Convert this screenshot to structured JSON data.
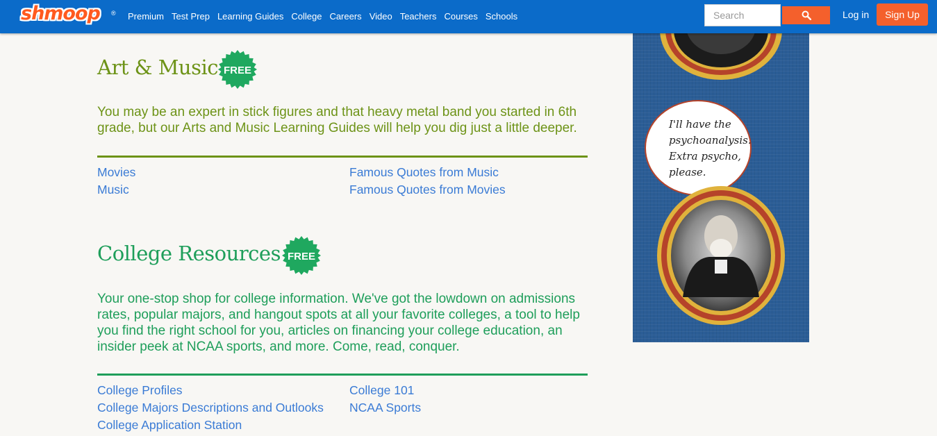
{
  "nav": {
    "logo": "shmoop",
    "registered": "®",
    "links": [
      "Premium",
      "Test Prep",
      "Learning Guides",
      "College",
      "Careers",
      "Video",
      "Teachers",
      "Courses",
      "Schools"
    ],
    "search_placeholder": "Search",
    "search_icon": "magnifier-icon",
    "login": "Log in",
    "signup": "Sign Up"
  },
  "sections": {
    "art": {
      "title": "Art & Music",
      "badge": "FREE",
      "description": "You may be an expert in stick figures and that heavy metal band you started in 6th grade, but our Arts and Music Learning Guides will help you dig just a little deeper.",
      "color": "#6d9317",
      "links_left": [
        "Movies",
        "Music"
      ],
      "links_right": [
        "Famous Quotes from Music",
        "Famous Quotes from Movies"
      ]
    },
    "college": {
      "title": "College Resources",
      "badge": "FREE",
      "description": "Your one-stop shop for college information. We've got the lowdown on admissions rates, popular majors, and hangout spots at all your favorite colleges, a tool to help you find the right school for you, articles on financing your college education, an insider peek at NCAA sports, and more. Come, read, conquer.",
      "color": "#1e9e5a",
      "links_left": [
        "College Profiles",
        "College Majors Descriptions and Outlooks",
        "College Application Station"
      ],
      "links_right": [
        "College 101",
        "NCAA Sports"
      ]
    }
  },
  "ad": {
    "bubble_lines": [
      "I'll have the",
      "psychoanalysis.",
      "Extra psycho,",
      "please."
    ],
    "background_color": "#2b5d96",
    "frame_color": "#b5432a"
  },
  "colors": {
    "nav_bg": "#0b6bc9",
    "accent_orange": "#f4602c",
    "badge_green": "#1fa85f",
    "link_blue": "#3a7bd5",
    "page_bg": "#f8f7f4"
  }
}
